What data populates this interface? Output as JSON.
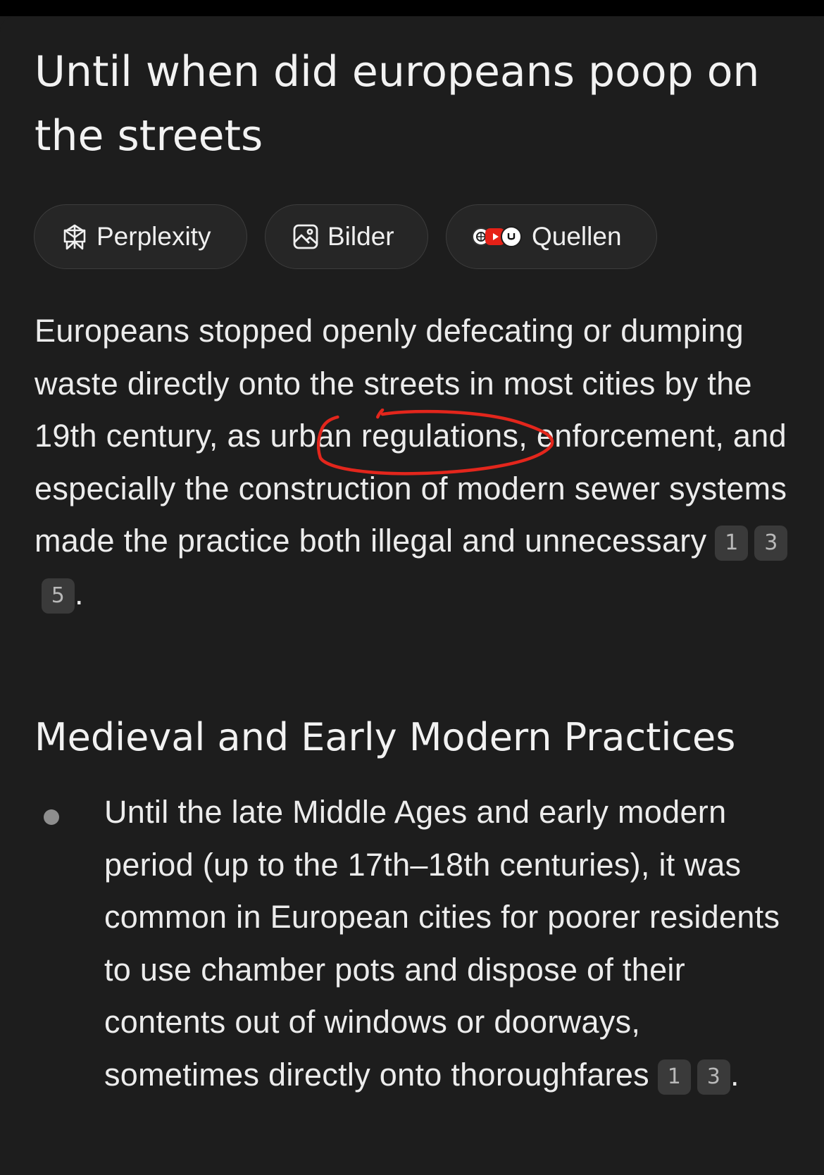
{
  "title": "Until when did europeans poop on the streets",
  "tabs": [
    {
      "label": "Perplexity",
      "icon": "perplexity-logo-icon"
    },
    {
      "label": "Bilder",
      "icon": "image-icon"
    },
    {
      "label": "Quellen",
      "icon": "sources-favicons-icon"
    }
  ],
  "answer": {
    "text_before": "Europeans stopped openly defecating or dumping waste directly onto the streets in most cities by the ",
    "highlight": "19th century,",
    "text_after": " as urban regulations, enforcement, and especially the construction of modern sewer systems made the practice both illegal and unnecessary",
    "citations": [
      "1",
      "3",
      "5"
    ],
    "end": "."
  },
  "section": {
    "heading": "Medieval and Early Modern Practices",
    "bullets": [
      {
        "text": "Until the late Middle Ages and early modern period (up to the 17th–18th centuries), it was common in European cities for poorer residents to use chamber pots and dispose of their contents out of windows or doorways, sometimes directly onto thoroughfares",
        "citations": [
          "1",
          "3"
        ],
        "end": "."
      }
    ]
  },
  "annotation_color": "#e3261c"
}
